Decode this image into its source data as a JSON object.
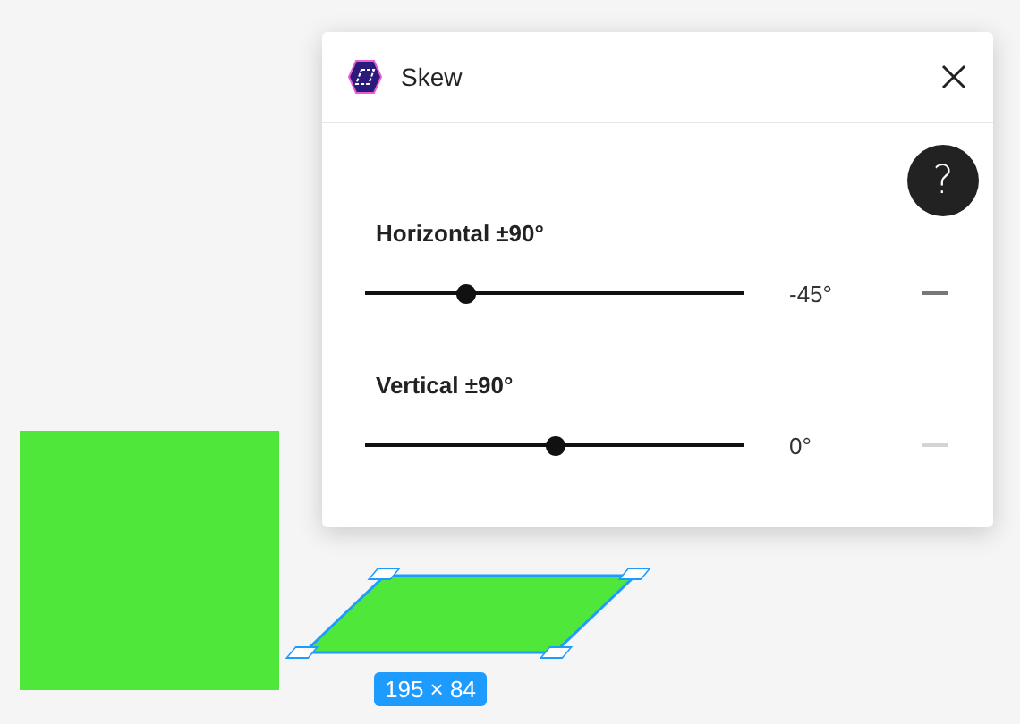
{
  "dialog": {
    "title": "Skew",
    "help": "?"
  },
  "sliders": [
    {
      "label": "Horizontal ±90°",
      "level": 0.265,
      "reading": "-45°",
      "reset_enabled": true
    },
    {
      "label": "Vertical ±90°",
      "level": 0.5,
      "reading": "0°",
      "reset_enabled": false
    }
  ],
  "selection": {
    "dimensions": "195 × 84"
  }
}
